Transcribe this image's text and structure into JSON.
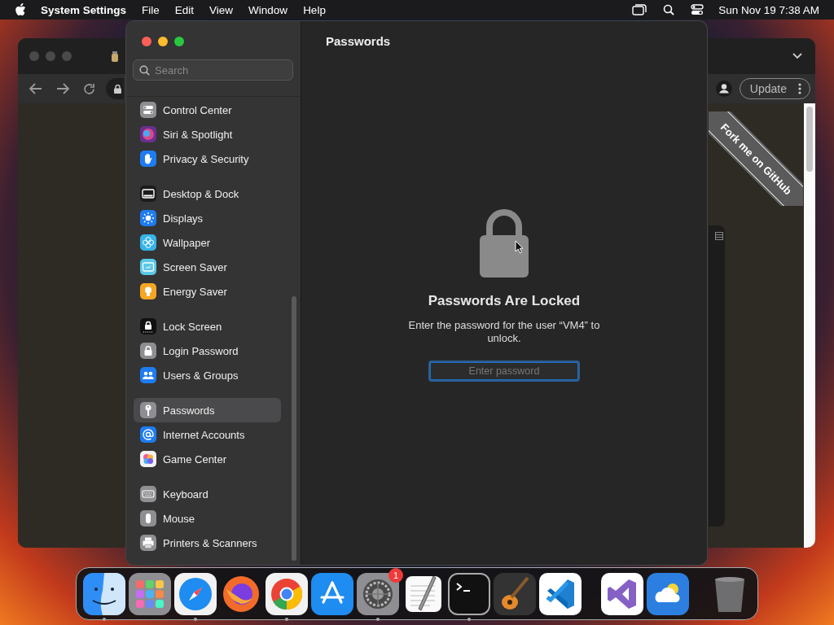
{
  "menu_bar": {
    "app_name": "System Settings",
    "menus": [
      "File",
      "Edit",
      "View",
      "Window",
      "Help"
    ],
    "clock": "Sun Nov 19  7:38 AM"
  },
  "browser": {
    "update_button": "Update",
    "ribbon": "Fork me on GitHub"
  },
  "settings": {
    "search": {
      "placeholder": "Search"
    },
    "sidebar": [
      [
        {
          "label": "Control Center",
          "kind": "toggles",
          "selected": false
        },
        {
          "label": "Siri & Spotlight",
          "kind": "orb",
          "selected": false
        },
        {
          "label": "Privacy & Security",
          "kind": "hand",
          "selected": false
        }
      ],
      [
        {
          "label": "Desktop & Dock",
          "kind": "desktop",
          "selected": false
        },
        {
          "label": "Displays",
          "kind": "sun",
          "selected": false
        },
        {
          "label": "Wallpaper",
          "kind": "flower",
          "selected": false
        },
        {
          "label": "Screen Saver",
          "kind": "screen",
          "selected": false
        },
        {
          "label": "Energy Saver",
          "kind": "bulb",
          "selected": false
        }
      ],
      [
        {
          "label": "Lock Screen",
          "kind": "lockscreen",
          "selected": false
        },
        {
          "label": "Login Password",
          "kind": "lock",
          "selected": false
        },
        {
          "label": "Users & Groups",
          "kind": "users",
          "selected": false
        }
      ],
      [
        {
          "label": "Passwords",
          "kind": "key",
          "selected": true
        },
        {
          "label": "Internet Accounts",
          "kind": "at",
          "selected": false
        },
        {
          "label": "Game Center",
          "kind": "bubbles",
          "selected": false
        }
      ],
      [
        {
          "label": "Keyboard",
          "kind": "keyboard",
          "selected": false
        },
        {
          "label": "Mouse",
          "kind": "mouse",
          "selected": false
        },
        {
          "label": "Printers & Scanners",
          "kind": "printer",
          "selected": false
        }
      ]
    ],
    "title": "Passwords",
    "locked_title": "Passwords Are Locked",
    "message": "Enter the password for the user “VM4” to unlock.",
    "password": {
      "placeholder": "Enter password"
    }
  },
  "dock": [
    {
      "kind": "finder",
      "running": true
    },
    {
      "kind": "launchpad",
      "running": false
    },
    {
      "kind": "safari",
      "running": true
    },
    {
      "kind": "firefox",
      "running": false
    },
    {
      "kind": "chrome",
      "running": true
    },
    {
      "kind": "appstore",
      "running": false
    },
    {
      "kind": "settings",
      "running": true,
      "badge": "1"
    },
    {
      "kind": "textedit",
      "running": false
    },
    {
      "kind": "terminal",
      "running": true
    },
    {
      "kind": "garageband",
      "running": false
    },
    {
      "kind": "vscode",
      "running": false
    },
    {
      "kind": "separator"
    },
    {
      "kind": "vstudio",
      "running": false
    },
    {
      "kind": "weather",
      "running": false
    },
    {
      "kind": "separator"
    },
    {
      "kind": "trash",
      "running": false
    }
  ]
}
